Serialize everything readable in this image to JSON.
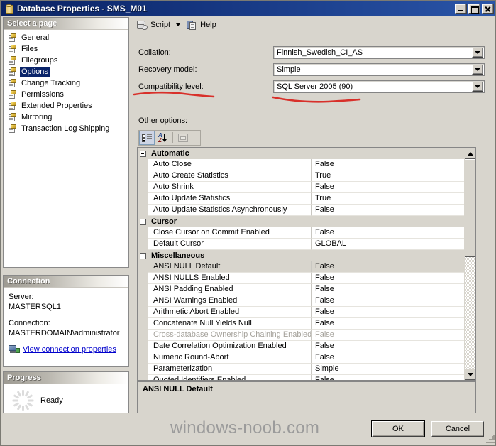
{
  "window": {
    "title": "Database Properties - SMS_M01",
    "icon": "database-icon",
    "minimize_label": "Minimize",
    "maximize_label": "Maximize",
    "close_label": "Close"
  },
  "sidebar": {
    "select_page_header": "Select a page",
    "pages": [
      {
        "label": "General",
        "selected": false
      },
      {
        "label": "Files",
        "selected": false
      },
      {
        "label": "Filegroups",
        "selected": false
      },
      {
        "label": "Options",
        "selected": true
      },
      {
        "label": "Change Tracking",
        "selected": false
      },
      {
        "label": "Permissions",
        "selected": false
      },
      {
        "label": "Extended Properties",
        "selected": false
      },
      {
        "label": "Mirroring",
        "selected": false
      },
      {
        "label": "Transaction Log Shipping",
        "selected": false
      }
    ],
    "connection": {
      "header": "Connection",
      "server_label": "Server:",
      "server_value": "MASTERSQL1",
      "connection_label": "Connection:",
      "connection_value": "MASTERDOMAIN\\administrator",
      "link_label": "View connection properties"
    },
    "progress": {
      "header": "Progress",
      "status": "Ready"
    }
  },
  "toolbar": {
    "script_label": "Script",
    "help_label": "Help"
  },
  "options": {
    "collation_label": "Collation:",
    "collation_value": "Finnish_Swedish_CI_AS",
    "recovery_label": "Recovery model:",
    "recovery_value": "Simple",
    "compatibility_label": "Compatibility level:",
    "compatibility_value": "SQL Server 2005 (90)",
    "other_options_label": "Other options:",
    "grid_toolbar": {
      "categorized_label": "Categorized",
      "alphabetical_label": "Alphabetical",
      "property_pages_label": "Property Pages"
    }
  },
  "grid": {
    "groups": [
      {
        "name": "Automatic",
        "rows": [
          {
            "name": "Auto Close",
            "value": "False"
          },
          {
            "name": "Auto Create Statistics",
            "value": "True"
          },
          {
            "name": "Auto Shrink",
            "value": "False"
          },
          {
            "name": "Auto Update Statistics",
            "value": "True"
          },
          {
            "name": "Auto Update Statistics Asynchronously",
            "value": "False"
          }
        ]
      },
      {
        "name": "Cursor",
        "rows": [
          {
            "name": "Close Cursor on Commit Enabled",
            "value": "False"
          },
          {
            "name": "Default Cursor",
            "value": "GLOBAL"
          }
        ]
      },
      {
        "name": "Miscellaneous",
        "rows": [
          {
            "name": "ANSI NULL Default",
            "value": "False",
            "selected": true
          },
          {
            "name": "ANSI NULLS Enabled",
            "value": "False"
          },
          {
            "name": "ANSI Padding Enabled",
            "value": "False"
          },
          {
            "name": "ANSI Warnings Enabled",
            "value": "False"
          },
          {
            "name": "Arithmetic Abort Enabled",
            "value": "False"
          },
          {
            "name": "Concatenate Null Yields Null",
            "value": "False"
          },
          {
            "name": "Cross-database Ownership Chaining Enabled",
            "value": "False",
            "disabled": true
          },
          {
            "name": "Date Correlation Optimization Enabled",
            "value": "False"
          },
          {
            "name": "Numeric Round-Abort",
            "value": "False"
          },
          {
            "name": "Parameterization",
            "value": "Simple"
          },
          {
            "name": "Quoted Identifiers Enabled",
            "value": "False",
            "clipped": true
          }
        ]
      }
    ]
  },
  "description": {
    "title": "ANSI NULL Default",
    "body": ""
  },
  "footer": {
    "watermark": "windows-noob.com",
    "ok_label": "OK",
    "cancel_label": "Cancel"
  },
  "colors": {
    "titlebar_start": "#0b2363",
    "titlebar_end": "#2a55a8",
    "selection": "#0a246a",
    "face": "#d8d5cd",
    "annotation_red": "#d8302a",
    "link": "#0000cc"
  }
}
